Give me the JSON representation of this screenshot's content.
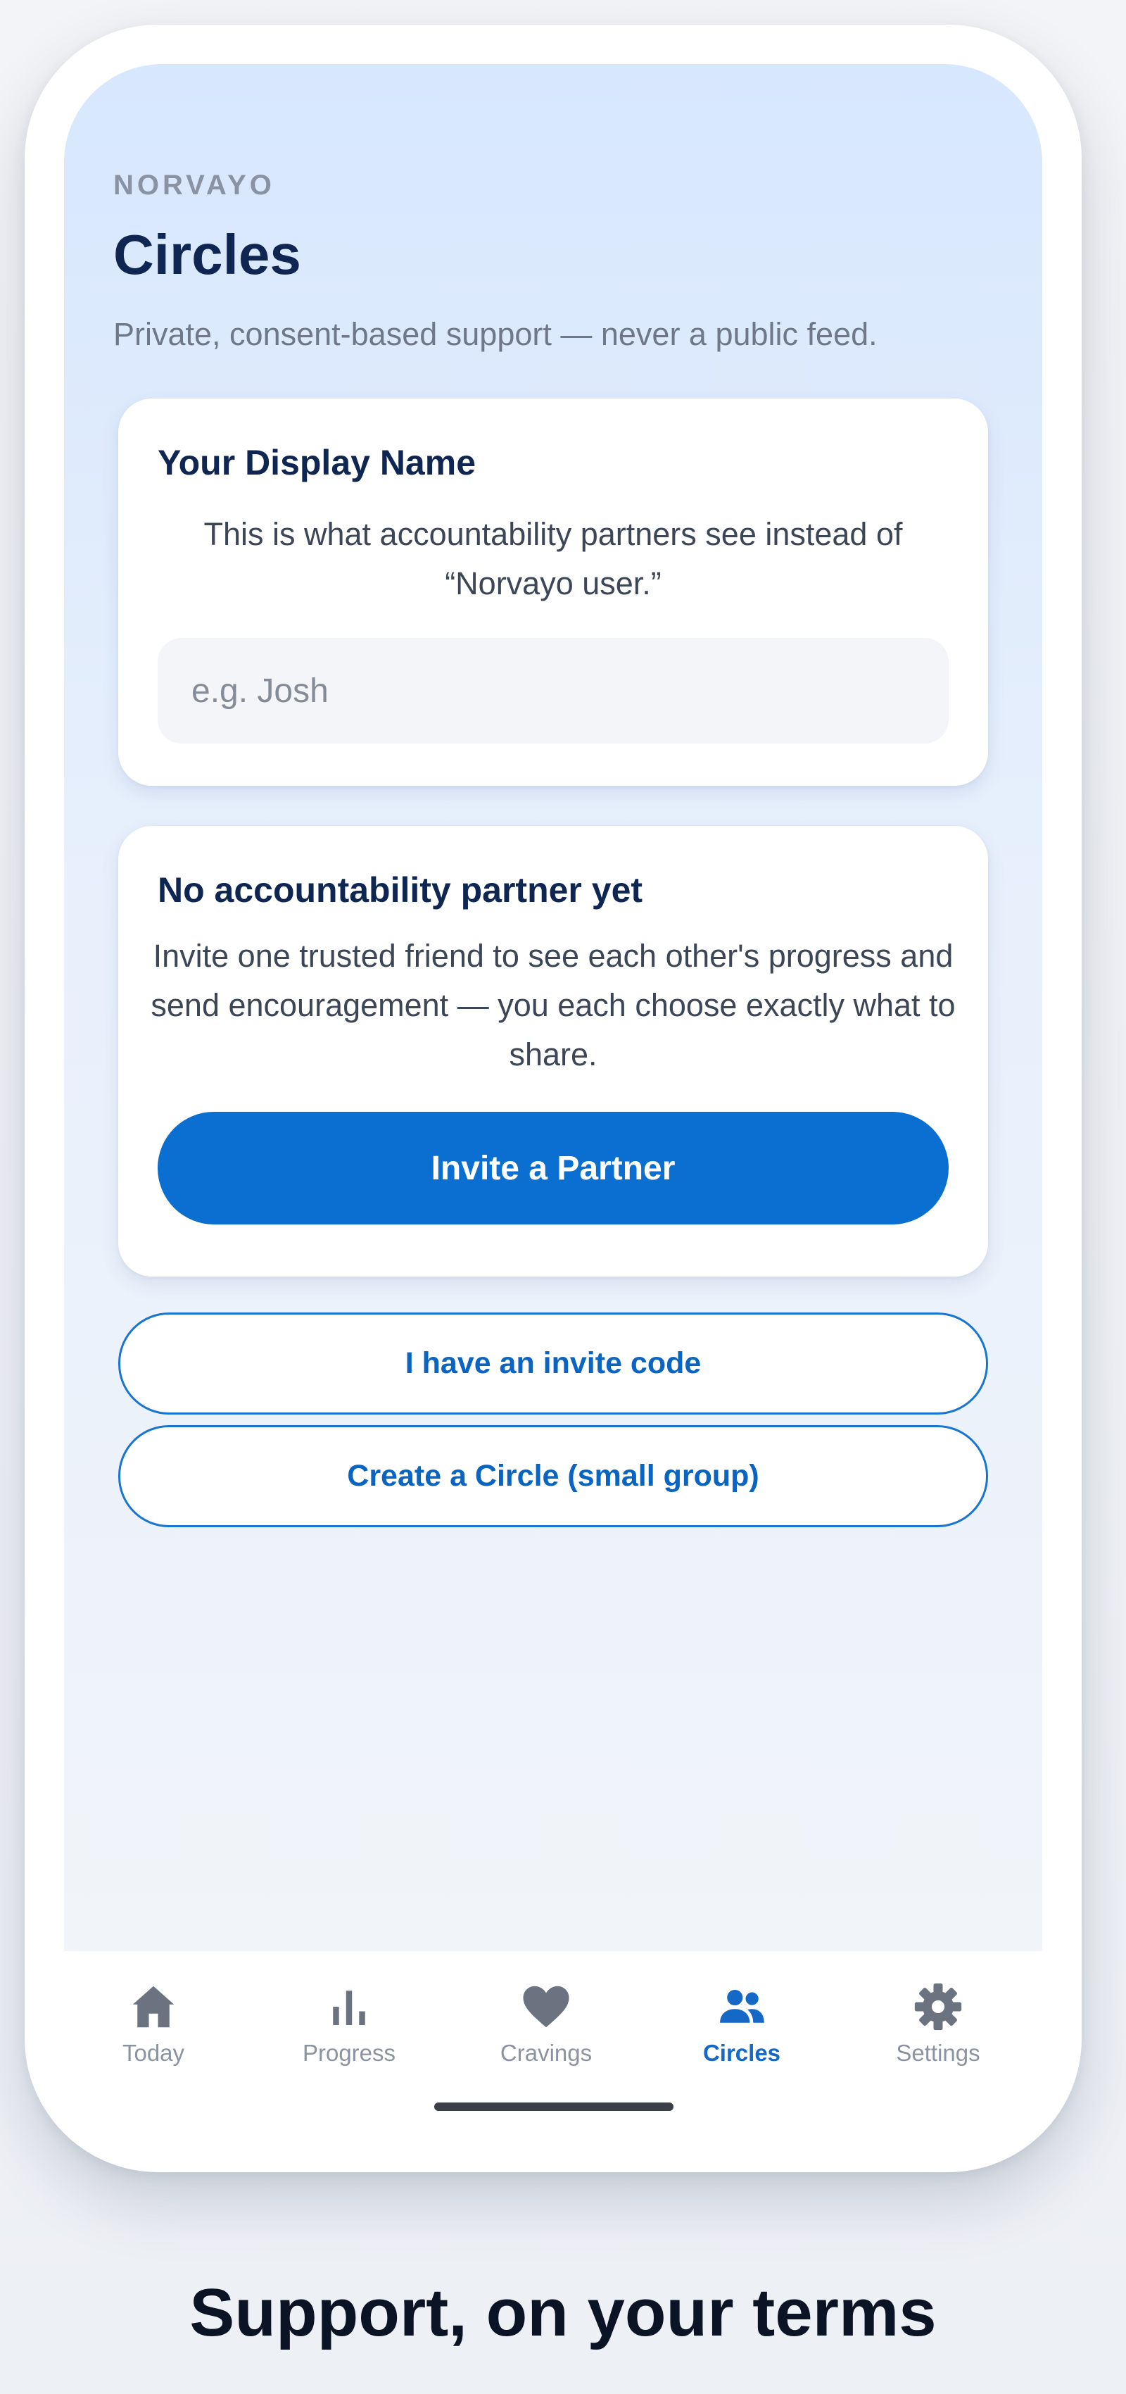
{
  "header": {
    "brand": "NORVAYO",
    "title": "Circles",
    "subtitle": "Private, consent-based support — never a public feed."
  },
  "display_name_card": {
    "title": "Your Display Name",
    "description": "This is what accountability partners see instead of “Norvayo user.”",
    "input_value": "",
    "input_placeholder": "e.g. Josh"
  },
  "partner_card": {
    "title": "No accountability partner yet",
    "description": "Invite one trusted friend to see each other's progress and send encouragement — you each choose exactly what to share.",
    "button_label": "Invite a Partner"
  },
  "actions": {
    "invite_code_label": "I have an invite code",
    "create_circle_label": "Create a Circle (small group)"
  },
  "tab_bar": {
    "items": [
      {
        "label": "Today",
        "icon": "home-icon",
        "active": false
      },
      {
        "label": "Progress",
        "icon": "bar-chart-icon",
        "active": false
      },
      {
        "label": "Cravings",
        "icon": "heart-icon",
        "active": false
      },
      {
        "label": "Circles",
        "icon": "people-icon",
        "active": true
      },
      {
        "label": "Settings",
        "icon": "gear-icon",
        "active": false
      }
    ]
  },
  "caption": "Support, on your terms",
  "colors": {
    "accent": "#0A6FD0",
    "title": "#0F2552",
    "muted": "#8B93A0",
    "inactive_icon": "#6B7380"
  }
}
